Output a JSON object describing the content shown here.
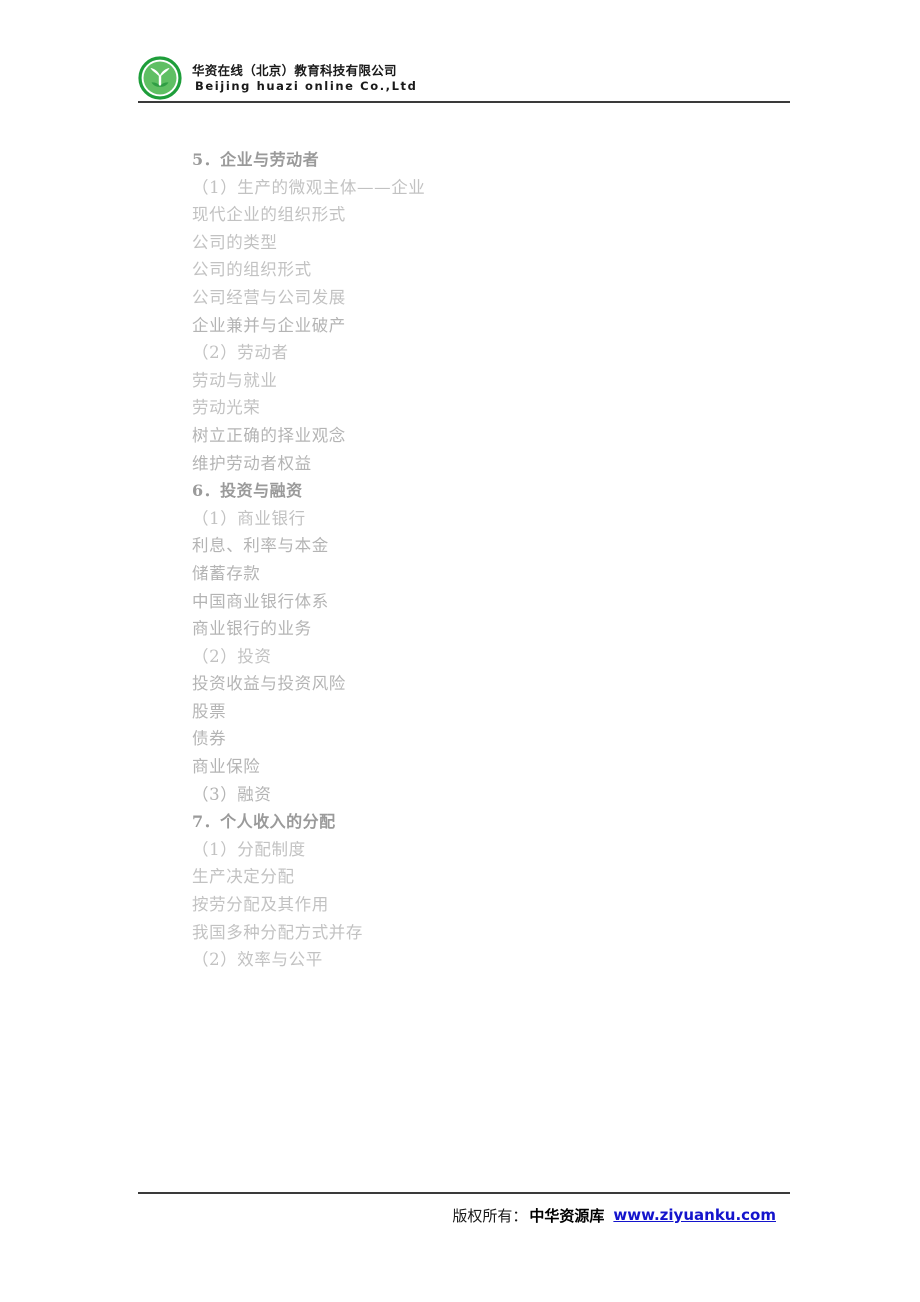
{
  "header": {
    "logo_icon": "green-circle-plant-logo",
    "company_cn": "华资在线（北京）教育科技有限公司",
    "company_en": "Beijing huazi online Co.,Ltd"
  },
  "outline": {
    "lines": [
      {
        "text": "5．企业与劳动者",
        "type": "heading"
      },
      {
        "text": "（1）生产的微观主体——企业",
        "type": "item"
      },
      {
        "text": "现代企业的组织形式",
        "type": "item"
      },
      {
        "text": "公司的类型",
        "type": "item"
      },
      {
        "text": "公司的组织形式",
        "type": "item"
      },
      {
        "text": "公司经营与公司发展",
        "type": "item"
      },
      {
        "text": "企业兼并与企业破产",
        "type": "item"
      },
      {
        "text": "（2）劳动者",
        "type": "item"
      },
      {
        "text": "劳动与就业",
        "type": "item"
      },
      {
        "text": "劳动光荣",
        "type": "item"
      },
      {
        "text": "树立正确的择业观念",
        "type": "item"
      },
      {
        "text": "维护劳动者权益",
        "type": "item"
      },
      {
        "text": "6．投资与融资",
        "type": "heading"
      },
      {
        "text": "（1）商业银行",
        "type": "item"
      },
      {
        "text": "利息、利率与本金",
        "type": "item"
      },
      {
        "text": "储蓄存款",
        "type": "item"
      },
      {
        "text": "中国商业银行体系",
        "type": "item"
      },
      {
        "text": "商业银行的业务",
        "type": "item"
      },
      {
        "text": "（2）投资",
        "type": "item"
      },
      {
        "text": "投资收益与投资风险",
        "type": "item"
      },
      {
        "text": "股票",
        "type": "item"
      },
      {
        "text": "债券",
        "type": "item"
      },
      {
        "text": "商业保险",
        "type": "item"
      },
      {
        "text": "（3）融资",
        "type": "item"
      },
      {
        "text": "7．个人收入的分配",
        "type": "heading"
      },
      {
        "text": "（1）分配制度",
        "type": "item"
      },
      {
        "text": "生产决定分配",
        "type": "item"
      },
      {
        "text": "按劳分配及其作用",
        "type": "item"
      },
      {
        "text": "我国多种分配方式并存",
        "type": "item"
      },
      {
        "text": "（2）效率与公平",
        "type": "item"
      }
    ]
  },
  "footer": {
    "copyright_label": "版权所有：",
    "organization": "中华资源库",
    "url": "www.ziyuanku.com",
    "url_color": "#1414cc"
  }
}
